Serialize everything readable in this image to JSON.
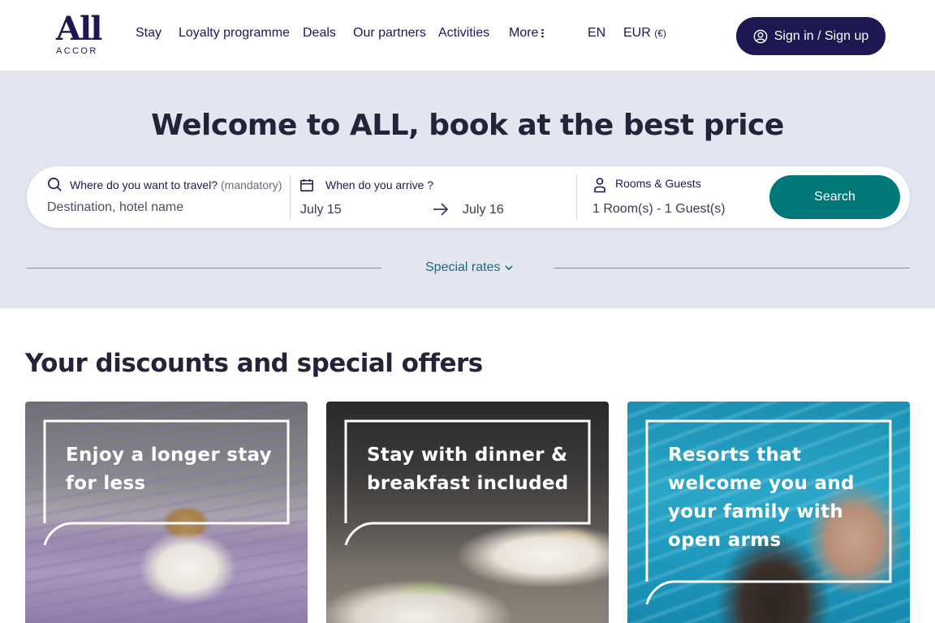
{
  "header": {
    "logo_main": "All",
    "logo_sub": "ACCOR",
    "nav": [
      {
        "label": "Stay"
      },
      {
        "label": "Loyalty programme"
      },
      {
        "label": "Deals"
      },
      {
        "label": "Our partners"
      },
      {
        "label": "Activities"
      },
      {
        "label": "More"
      }
    ],
    "language": "EN",
    "currency": "EUR",
    "currency_symbol": "(€)",
    "signin_label": "Sign in / Sign up"
  },
  "hero": {
    "title": "Welcome to ALL, book at the best price",
    "destination": {
      "label": "Where do you want to travel?",
      "label_hint": "(mandatory)",
      "placeholder": "Destination, hotel name"
    },
    "dates": {
      "label": "When do you arrive ?",
      "arrival": "July 15",
      "departure": "July 16"
    },
    "guests": {
      "label": "Rooms & Guests",
      "value": "1 Room(s) - 1 Guest(s)"
    },
    "search_label": "Search",
    "special_rates_label": "Special rates"
  },
  "offers": {
    "title": "Your discounts and special offers",
    "cards": [
      {
        "text": "Enjoy a longer stay for less",
        "lines": [
          "Enjoy a longer stay",
          "for less"
        ]
      },
      {
        "text": "Stay with dinner & breakfast included",
        "lines": [
          "Stay with dinner &",
          "breakfast included"
        ]
      },
      {
        "text": "Resorts that welcome you and your family with open arms",
        "lines": [
          "Resorts that",
          "welcome you and",
          "your family with",
          "open arms"
        ]
      }
    ]
  },
  "colors": {
    "brand_navy": "#1e1852",
    "accent_teal": "#00787a",
    "hero_bg": "#e3e6f1"
  }
}
